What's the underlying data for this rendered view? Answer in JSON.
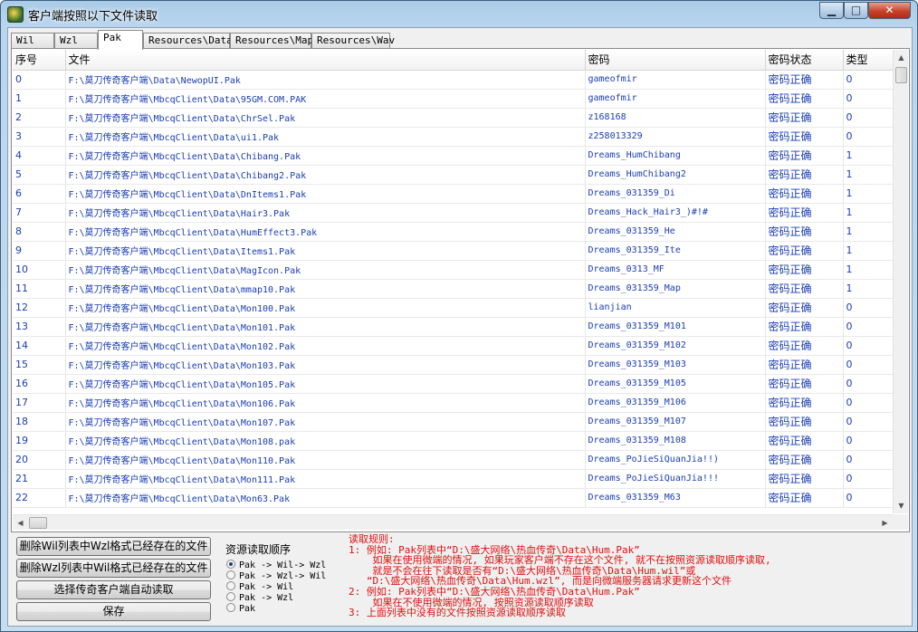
{
  "window": {
    "title": "客户端按照以下文件读取",
    "controls": {
      "minimize": "▁",
      "maximize": "□",
      "close": "✕"
    }
  },
  "tabs": [
    "Wil",
    "Wzl",
    "Pak",
    "Resources\\Data",
    "Resources\\Map",
    "Resources\\Wav"
  ],
  "table": {
    "headers": [
      "序号",
      "文件",
      "密码",
      "密码状态",
      "类型"
    ],
    "rows": [
      [
        "0",
        "F:\\莫刀传奇客户端\\Data\\NewopUI.Pak",
        "gameofmir",
        "密码正确",
        "0"
      ],
      [
        "1",
        "F:\\莫刀传奇客户端\\MbcqClient\\Data\\95GM.COM.PAK",
        "gameofmir",
        "密码正确",
        "0"
      ],
      [
        "2",
        "F:\\莫刀传奇客户端\\MbcqClient\\Data\\ChrSel.Pak",
        "z168168",
        "密码正确",
        "0"
      ],
      [
        "3",
        "F:\\莫刀传奇客户端\\MbcqClient\\Data\\ui1.Pak",
        "z258013329",
        "密码正确",
        "0"
      ],
      [
        "4",
        "F:\\莫刀传奇客户端\\MbcqClient\\Data\\Chibang.Pak",
        "Dreams_HumChibang",
        "密码正确",
        "1"
      ],
      [
        "5",
        "F:\\莫刀传奇客户端\\MbcqClient\\Data\\Chibang2.Pak",
        "Dreams_HumChibang2",
        "密码正确",
        "1"
      ],
      [
        "6",
        "F:\\莫刀传奇客户端\\MbcqClient\\Data\\DnItems1.Pak",
        "Dreams_031359_Di",
        "密码正确",
        "1"
      ],
      [
        "7",
        "F:\\莫刀传奇客户端\\MbcqClient\\Data\\Hair3.Pak",
        "Dreams_Hack_Hair3_)#!#",
        "密码正确",
        "1"
      ],
      [
        "8",
        "F:\\莫刀传奇客户端\\MbcqClient\\Data\\HumEffect3.Pak",
        "Dreams_031359_He",
        "密码正确",
        "1"
      ],
      [
        "9",
        "F:\\莫刀传奇客户端\\MbcqClient\\Data\\Items1.Pak",
        "Dreams_031359_Ite",
        "密码正确",
        "1"
      ],
      [
        "10",
        "F:\\莫刀传奇客户端\\MbcqClient\\Data\\MagIcon.Pak",
        "Dreams_0313_MF",
        "密码正确",
        "1"
      ],
      [
        "11",
        "F:\\莫刀传奇客户端\\MbcqClient\\Data\\mmap10.Pak",
        "Dreams_031359_Map",
        "密码正确",
        "1"
      ],
      [
        "12",
        "F:\\莫刀传奇客户端\\MbcqClient\\Data\\Mon100.Pak",
        "lianjian",
        "密码正确",
        "0"
      ],
      [
        "13",
        "F:\\莫刀传奇客户端\\MbcqClient\\Data\\Mon101.Pak",
        "Dreams_031359_M101",
        "密码正确",
        "0"
      ],
      [
        "14",
        "F:\\莫刀传奇客户端\\MbcqClient\\Data\\Mon102.Pak",
        "Dreams_031359_M102",
        "密码正确",
        "0"
      ],
      [
        "15",
        "F:\\莫刀传奇客户端\\MbcqClient\\Data\\Mon103.Pak",
        "Dreams_031359_M103",
        "密码正确",
        "0"
      ],
      [
        "16",
        "F:\\莫刀传奇客户端\\MbcqClient\\Data\\Mon105.Pak",
        "Dreams_031359_M105",
        "密码正确",
        "0"
      ],
      [
        "17",
        "F:\\莫刀传奇客户端\\MbcqClient\\Data\\Mon106.Pak",
        "Dreams_031359_M106",
        "密码正确",
        "0"
      ],
      [
        "18",
        "F:\\莫刀传奇客户端\\MbcqClient\\Data\\Mon107.Pak",
        "Dreams_031359_M107",
        "密码正确",
        "0"
      ],
      [
        "19",
        "F:\\莫刀传奇客户端\\MbcqClient\\Data\\Mon108.pak",
        "Dreams_031359_M108",
        "密码正确",
        "0"
      ],
      [
        "20",
        "F:\\莫刀传奇客户端\\MbcqClient\\Data\\Mon110.Pak",
        "Dreams_PoJieSiQuanJia!!)",
        "密码正确",
        "0"
      ],
      [
        "21",
        "F:\\莫刀传奇客户端\\MbcqClient\\Data\\Mon111.Pak",
        "Dreams_PoJieSiQuanJia!!!",
        "密码正确",
        "0"
      ],
      [
        "22",
        "F:\\莫刀传奇客户端\\MbcqClient\\Data\\Mon63.Pak",
        "Dreams_031359_M63",
        "密码正确",
        "0"
      ]
    ]
  },
  "buttons": {
    "delete_wil": "删除Wil列表中Wzl格式已经存在的文件",
    "delete_wzl": "删除Wzl列表中Wil格式已经存在的文件",
    "auto_read": "选择传奇客户端自动读取",
    "save": "保存"
  },
  "read_order": {
    "title": "资源读取顺序",
    "selected_index": 0,
    "options": [
      "Pak -> Wil-> Wzl",
      "Pak -> Wzl-> Wil",
      "Pak -> Wil",
      "Pak -> Wzl",
      "Pak"
    ]
  },
  "rules": {
    "lines": [
      "读取规则:",
      "1: 例如: Pak列表中“D:\\盛大网络\\热血传奇\\Data\\Hum.Pak”",
      "    如果在使用微端的情况, 如果玩家客户端不存在这个文件, 就不在按照资源读取顺序读取,",
      "    就是不会在往下读取是否有“D:\\盛大网络\\热血传奇\\Data\\Hum.wil”或",
      "   “D:\\盛大网络\\热血传奇\\Data\\Hum.wzl”, 而是向微端服务器请求更新这个文件",
      "2: 例如: Pak列表中“D:\\盛大网络\\热血传奇\\Data\\Hum.Pak”",
      "    如果在不使用微端的情况, 按照资源读取顺序读取",
      "3: 上面列表中没有的文件按照资源读取顺序读取"
    ]
  },
  "colors": {
    "link_blue": "#1a3db5",
    "rules_red": "#e01010"
  },
  "icons": {
    "app": "app-logo-icon",
    "radio": "radio-button-icon"
  }
}
